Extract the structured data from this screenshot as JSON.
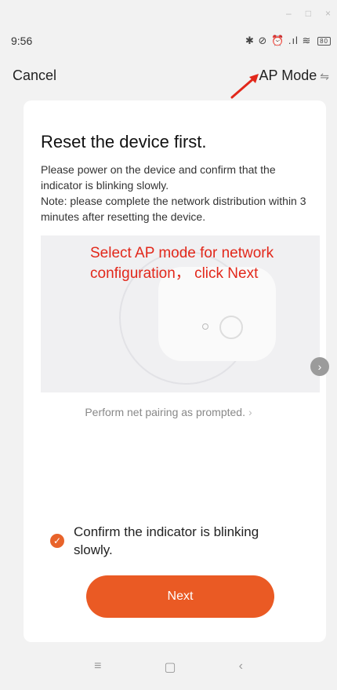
{
  "window_controls": {
    "minimize": "–",
    "maximize": "□",
    "close": "×"
  },
  "status_bar": {
    "time": "9:56",
    "icons": "✱ ⊘ ⏰ .ıl ≋",
    "battery": "80"
  },
  "topbar": {
    "cancel_label": "Cancel",
    "mode_label": "AP Mode",
    "mode_icon": "⇋"
  },
  "content": {
    "title": "Reset the device first.",
    "description_lines": [
      "Please power on the device and confirm that the indicator is blinking slowly.",
      "Note: please complete the network distribution within 3 minutes after resetting the device."
    ],
    "annotation_lines": [
      "Select AP mode for network",
      "configuration， click  Next"
    ],
    "next_arrow": "›",
    "prompt_link": "Perform net pairing as prompted.",
    "prompt_chevron": "›",
    "confirm_check": "✓",
    "confirm_label": "Confirm the indicator is blinking slowly.",
    "next_button": "Next"
  },
  "nav": {
    "menu": "≡",
    "home": "▢",
    "back": "‹"
  },
  "colors": {
    "accent": "#ea5a24",
    "annotation": "#e2281b",
    "background": "#f2f2f2"
  }
}
